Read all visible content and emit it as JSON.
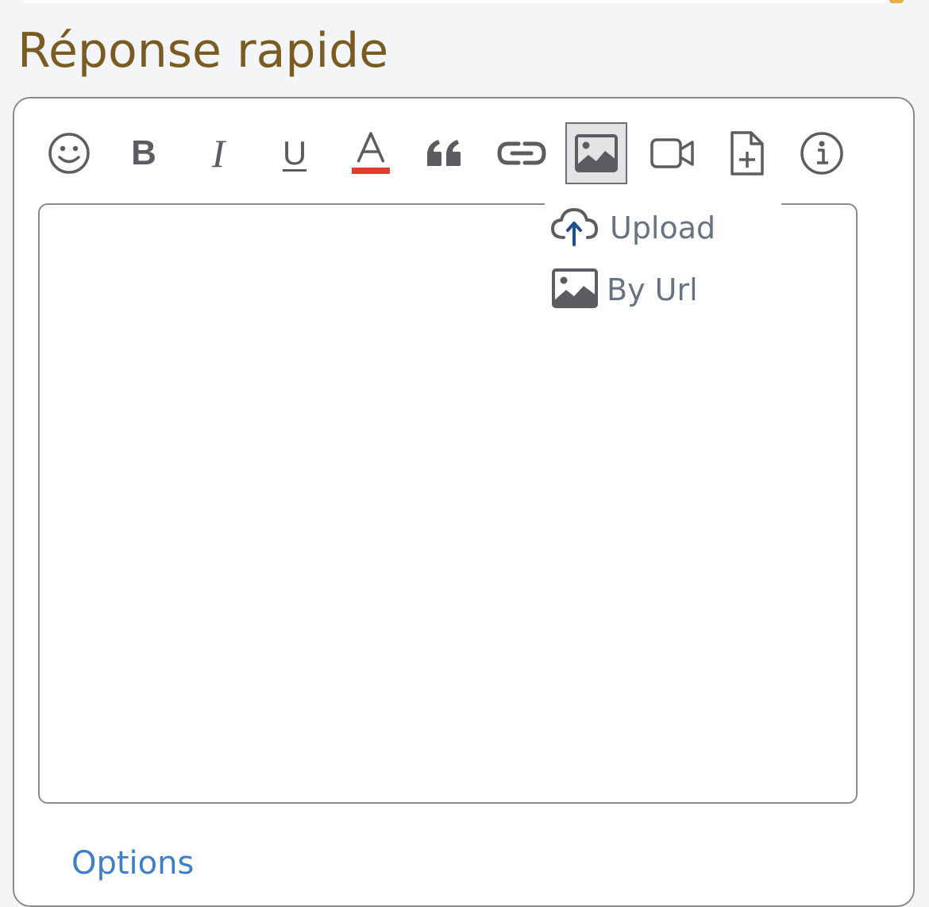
{
  "page": {
    "title": "Réponse rapide"
  },
  "toolbar": {
    "buttons": [
      {
        "id": "smilies",
        "icon": "smiley-icon"
      },
      {
        "id": "bold",
        "icon": "bold-icon",
        "glyph": "B"
      },
      {
        "id": "italic",
        "icon": "italic-icon",
        "glyph": "I"
      },
      {
        "id": "underline",
        "icon": "underline-icon",
        "glyph": "U"
      },
      {
        "id": "font-color",
        "icon": "font-color-icon",
        "glyph": "A"
      },
      {
        "id": "quote",
        "icon": "quote-icon"
      },
      {
        "id": "link",
        "icon": "link-icon"
      },
      {
        "id": "image",
        "icon": "image-icon",
        "active": true
      },
      {
        "id": "video",
        "icon": "video-icon"
      },
      {
        "id": "attachment",
        "icon": "file-add-icon"
      },
      {
        "id": "info",
        "icon": "info-icon"
      }
    ],
    "accent_color": "#e33b2e"
  },
  "image_menu": {
    "items": [
      {
        "label": "Upload",
        "icon": "cloud-upload-icon"
      },
      {
        "label": "By Url",
        "icon": "image-icon"
      }
    ]
  },
  "editor": {
    "value": ""
  },
  "footer": {
    "options_link": "Options"
  },
  "colors": {
    "title": "#7a5c22",
    "menu_text": "#677283",
    "link": "#3f7fc8",
    "icon": "#5d5d61",
    "upload_arrow": "#1f4f8f"
  }
}
